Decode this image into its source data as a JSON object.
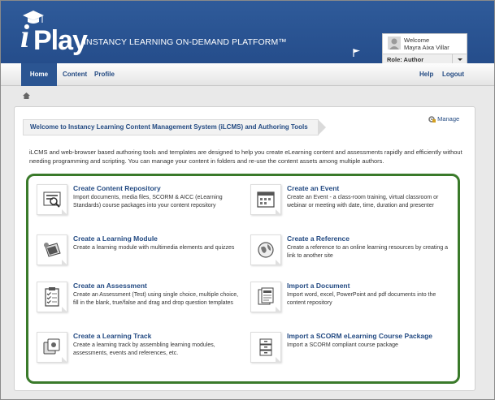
{
  "app": {
    "logo_text": "iPlay",
    "logo_i": "i",
    "logo_play": "Play",
    "platform_title": "INSTANCY LEARNING ON-DEMAND PLATFORM™"
  },
  "user": {
    "welcome_label": "Welcome",
    "name": "Mayra Aixa Villar",
    "role": "Role: Author"
  },
  "nav": {
    "home": "Home",
    "content": "Content",
    "profile": "Profile",
    "help": "Help",
    "logout": "Logout"
  },
  "main": {
    "welcome_title": "Welcome to Instancy Learning Content Management System (iLCMS) and Authoring Tools",
    "manage_label": "Manage",
    "intro": "iLCMS and web-browser based authoring tools and templates are designed to help you create eLearning content and assessments rapidly and efficiently without needing programming and scripting. You can manage your content in folders and re-use the content assets among multiple authors."
  },
  "tiles": [
    {
      "title": "Create Content Repository",
      "desc": "Import documents, media files, SCORM & AICC (eLearning Standards) course packages into your content repository",
      "icon": "repository-icon"
    },
    {
      "title": "Create an Event",
      "desc": "Create an Event - a class-room training, virtual classroom or webinar or meeting with date, time, duration and presenter",
      "icon": "calendar-icon"
    },
    {
      "title": "Create a Learning Module",
      "desc": "Create a learning module with multimedia elements and quizzes",
      "icon": "module-icon"
    },
    {
      "title": "Create a Reference",
      "desc": "Create a reference to an online learning resources by creating a link to another site",
      "icon": "globe-icon"
    },
    {
      "title": "Create an Assessment",
      "desc": "Create an Assessment (Test) using single choice, multiple choice, fill in the blank, true/false and drag and drop question templates",
      "icon": "clipboard-icon"
    },
    {
      "title": "Import a Document",
      "desc": "Import word, excel, PowerPoint and pdf documents into the content repository",
      "icon": "document-icon"
    },
    {
      "title": "Create a Learning Track",
      "desc": "Create a learning track by assembling learning modules, assessments, events and references, etc.",
      "icon": "track-icon"
    },
    {
      "title": "Import a SCORM eLearning Course Package",
      "desc": "Import a SCORM compliant course package",
      "icon": "package-icon"
    }
  ],
  "colors": {
    "header": "#2b5592",
    "link": "#244b83",
    "tiles_border": "#3a7a2a"
  }
}
